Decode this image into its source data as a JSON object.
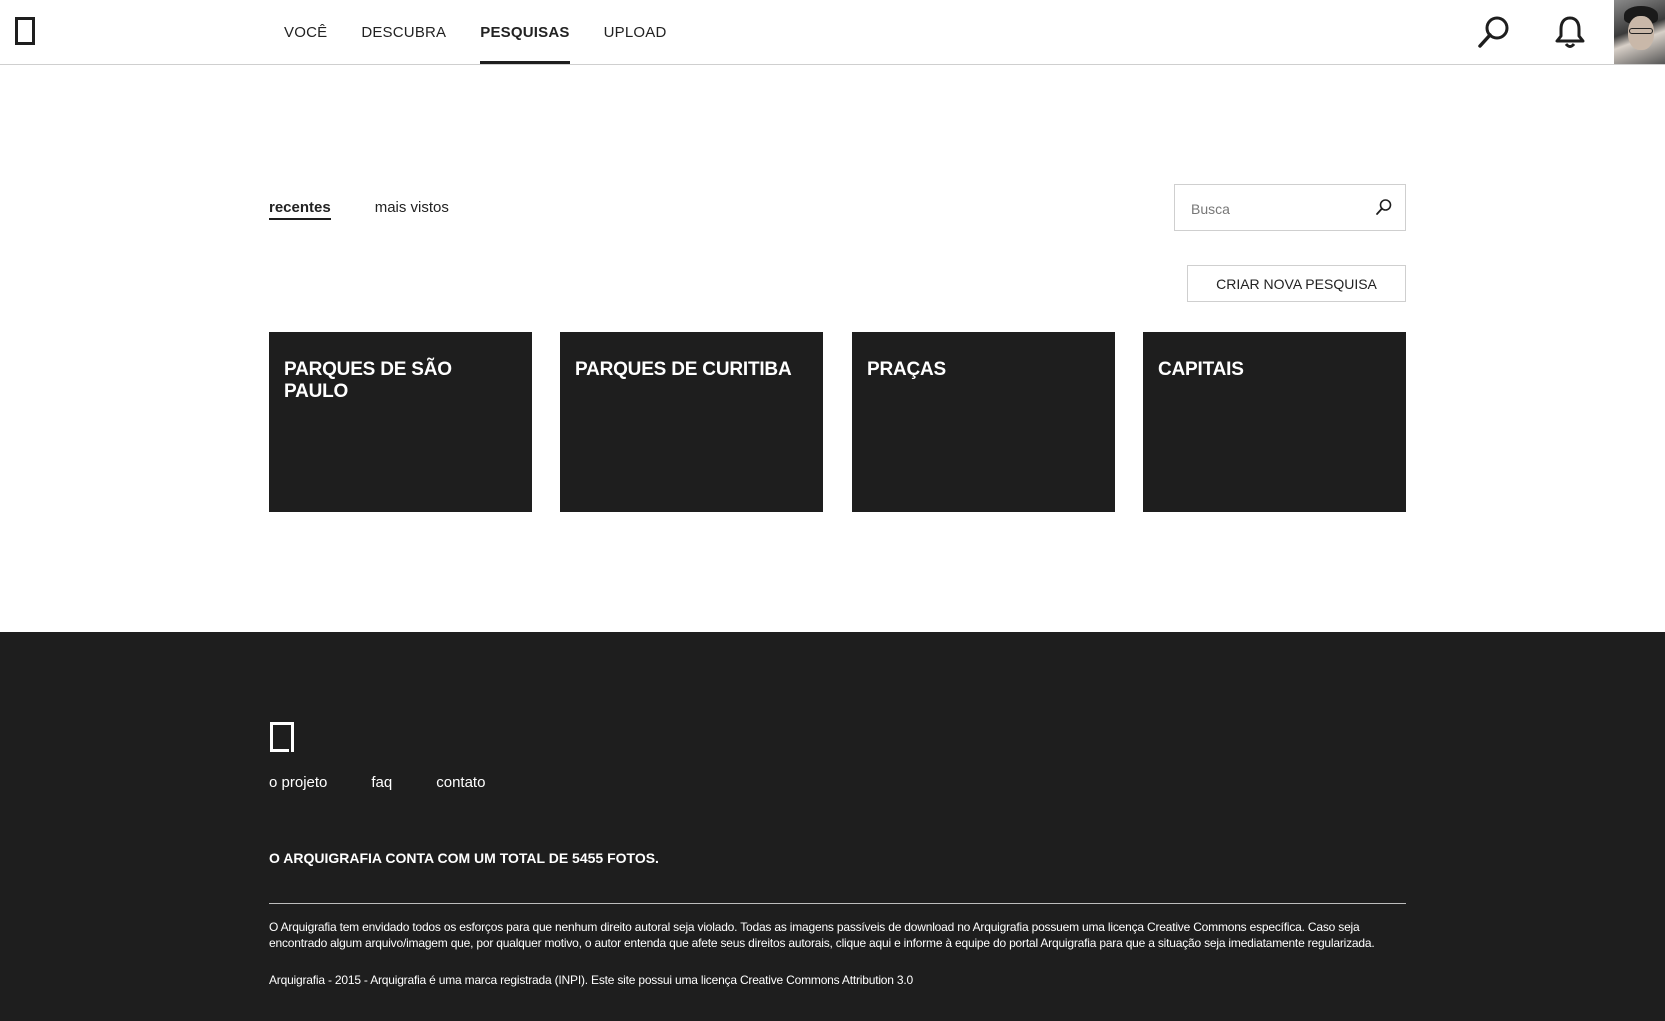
{
  "header": {
    "nav": [
      {
        "label": "VOCÊ",
        "active": false
      },
      {
        "label": "DESCUBRA",
        "active": false
      },
      {
        "label": "PESQUISAS",
        "active": true
      },
      {
        "label": "UPLOAD",
        "active": false
      }
    ],
    "icons": {
      "search": "search-icon",
      "notifications": "bell-icon",
      "avatar": "avatar"
    }
  },
  "filters": [
    {
      "label": "recentes",
      "active": true
    },
    {
      "label": "mais vistos",
      "active": false
    }
  ],
  "search": {
    "placeholder": "Busca",
    "value": ""
  },
  "create_button": "CRIAR NOVA PESQUISA",
  "cards": [
    {
      "title": "PARQUES DE SÃO PAULO"
    },
    {
      "title": "PARQUES DE CURITIBA"
    },
    {
      "title": "PRAÇAS"
    },
    {
      "title": "CAPITAIS"
    }
  ],
  "footer": {
    "links": [
      "o projeto",
      "faq",
      "contato"
    ],
    "total": "O ARQUIGRAFIA CONTA COM UM TOTAL DE 5455 FOTOS.",
    "disclaimer": "O Arquigrafia tem envidado todos os esforços para que nenhum direito autoral seja violado. Todas as imagens passíveis de download no Arquigrafia possuem uma licença Creative Commons específica. Caso seja encontrado algum arquivo/imagem que, por qualquer motivo, o autor entenda que afete seus direitos autorais, clique aqui e informe à equipe do portal Arquigrafia para que a situação seja imediatamente regularizada.",
    "copyright": "Arquigrafia - 2015 - Arquigrafia é uma marca registrada (INPI). Este site possui uma licença Creative Commons Attribution 3.0"
  },
  "colors": {
    "dark": "#1e1e1e",
    "border": "#cfcfcf",
    "background": "#ffffff"
  }
}
